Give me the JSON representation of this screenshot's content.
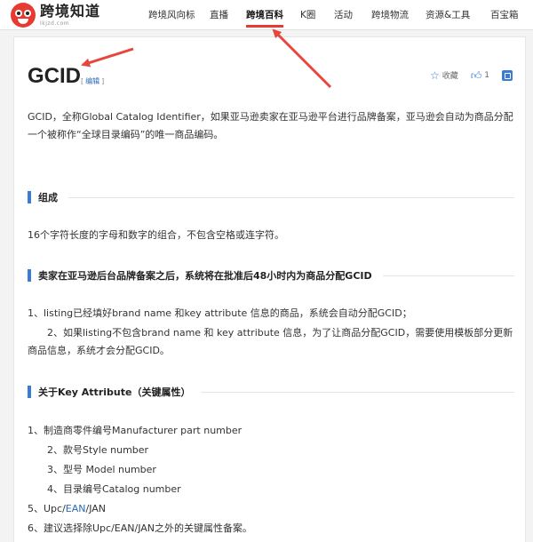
{
  "header": {
    "logo_name": "跨境知道",
    "logo_tagline": "Ikjzd.com",
    "nav": [
      {
        "label": "跨境风向标",
        "active": false
      },
      {
        "label": "直播",
        "active": false
      },
      {
        "label": "跨境百科",
        "active": true
      },
      {
        "label": "K圈",
        "active": false
      },
      {
        "label": "活动",
        "active": false
      },
      {
        "label": "跨境物流",
        "active": false
      },
      {
        "label": "资源&工具",
        "active": false
      },
      {
        "label": "百宝箱",
        "active": false
      }
    ]
  },
  "article": {
    "title": "GCID",
    "edit_open": "[",
    "edit_label": "编辑",
    "edit_close": "]",
    "actions": {
      "favorite_label": "收藏",
      "like_count": "1"
    },
    "intro": "GCID，全称Global Catalog Identifier，如果亚马逊卖家在亚马逊平台进行品牌备案，亚马逊会自动为商品分配一个被称作“全球目录编码”的唯一商品编码。",
    "sections": [
      {
        "title": "组成"
      },
      {
        "title": "卖家在亚马逊后台品牌备案之后，系统将在批准后48小时内为商品分配GCID"
      },
      {
        "title": "关于Key Attribute（关键属性）"
      }
    ],
    "composition": "16个字符长度的字母和数字的组合，不包含空格或连字符。",
    "assignment": [
      "1、listing已经填好brand name 和key attribute 信息的商品，系统会自动分配GCID；",
      "2、如果listing不包含brand name 和 key attribute 信息，为了让商品分配GCID，需要使用模板部分更新商品信息，系统才会分配GCID。"
    ],
    "key_attributes": {
      "item1": "1、制造商零件编号Manufacturer part number",
      "sub": [
        "2、款号Style number",
        "3、型号 Model number",
        "4、目录编号Catalog number"
      ],
      "item5_prefix": "5、Upc/",
      "item5_link": "EAN",
      "item5_suffix": "/JAN",
      "item6": "6、建议选择除Upc/EAN/JAN之外的关键属性备案。"
    }
  },
  "colors": {
    "accent_red": "#e83a31",
    "accent_blue": "#3a7bd5",
    "link_blue": "#2b6bb5"
  }
}
